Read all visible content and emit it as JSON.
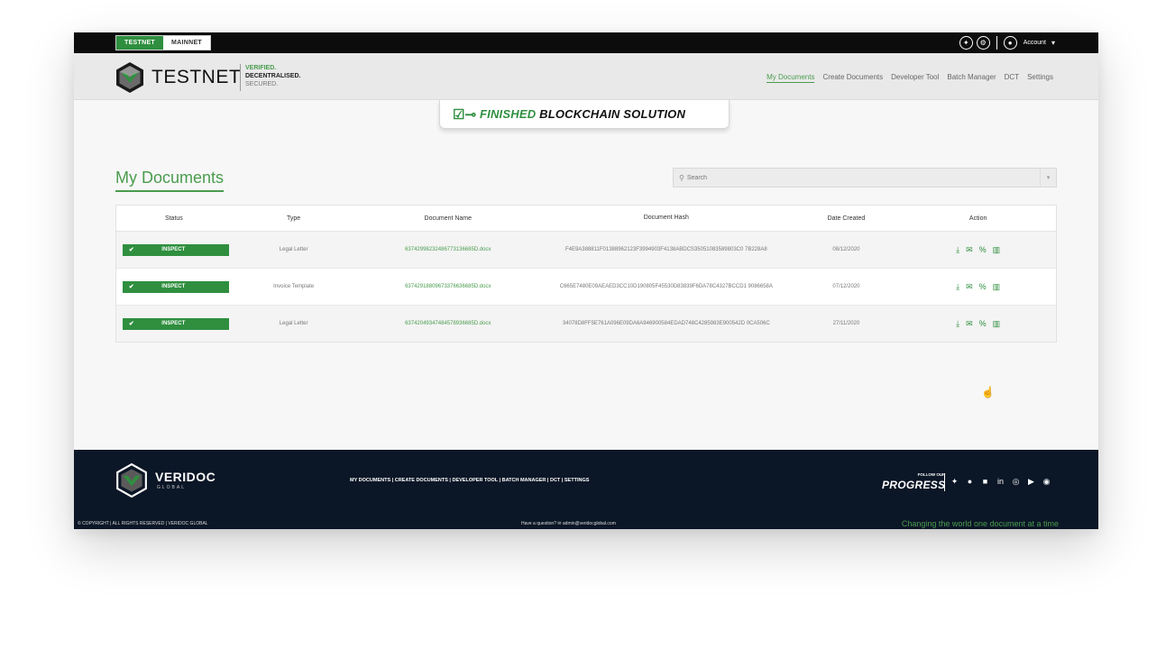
{
  "network": {
    "testnet_label": "TESTNET",
    "mainnet_label": "MAINNET"
  },
  "topbar": {
    "account_label": "Account"
  },
  "header": {
    "brand": "TESTNET",
    "tagline": [
      "VERIFIED.",
      "DECENTRALISED.",
      "SECURED."
    ],
    "nav": [
      "My Documents",
      "Create Documents",
      "Developer Tool",
      "Batch Manager",
      "DCT",
      "Settings"
    ]
  },
  "banner": {
    "text_green": "FINISHED",
    "text_dark": "BLOCKCHAIN SOLUTION"
  },
  "main": {
    "title": "My Documents",
    "search_placeholder": "Search"
  },
  "table": {
    "headers": [
      "Status",
      "Type",
      "Document Name",
      "Document Hash",
      "Date Created",
      "Action"
    ],
    "rows": [
      {
        "status": "INSPECT",
        "type": "Legal Letter",
        "name": "6374299823248677313668​5D.docx",
        "hash": "F4E9A388811F01388962123F3994903F4138ABDCS35051083589803C0 7B228A8",
        "date": "08/12/2020"
      },
      {
        "status": "INSPECT",
        "type": "Invoice Template",
        "name": "63742918809673376636685D.docx",
        "hash": "C665E7480E09AEAED3CC10D190805F45530D83839F6DA78C4327BCCD1 9086658A",
        "date": "07/12/2020"
      },
      {
        "status": "INSPECT",
        "type": "Legal Letter",
        "name": "63742049347484578936685D.docx",
        "hash": "34078D8FF5E761A096E09DA6A946900584EDAD748C4285983E900542D 0CA506C",
        "date": "27/11/2020"
      }
    ]
  },
  "footer": {
    "brand": "VERIDOC",
    "brand_sub": "GLOBAL",
    "nav": "MY DOCUMENTS | CREATE DOCUMENTS | DEVELOPER TOOL | BATCH MANAGER | DCT | SETTINGS",
    "follow_small": "FOLLOW OUR",
    "follow_big": "PROGRESS",
    "copyright": "© COPYRIGHT | ALL RIGHTS RESERVED | VERIDOC GLOBAL",
    "question": "Have a question? ✉ admin@veridocglobal.com",
    "slogan": "Changing the world one document at a time"
  },
  "colors": {
    "accent": "#2f8f3f",
    "link": "#4a9c4e",
    "footer_bg": "#0b1626"
  }
}
